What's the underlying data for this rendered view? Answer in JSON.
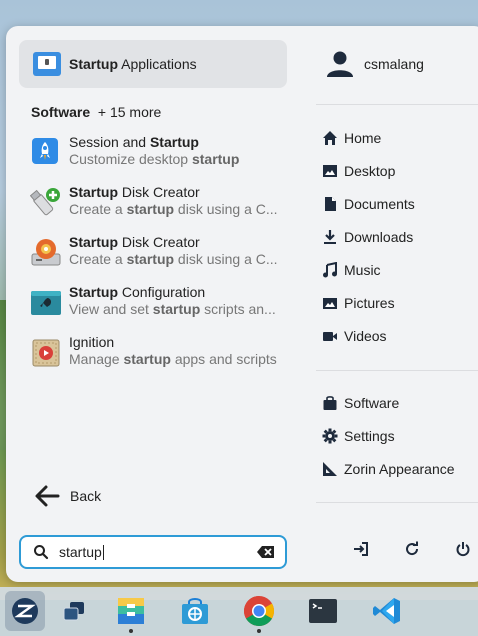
{
  "top_result": {
    "bold": "Startup",
    "rest": " Applications"
  },
  "category": {
    "name": "Software",
    "more": "+ 15 more"
  },
  "results": [
    {
      "t1_bold": "",
      "t1_rest": "Session and ",
      "t1_tail": "Startup",
      "t2_pre": "Customize desktop ",
      "t2_bold": "startup",
      "t2_post": "",
      "icon": "rocket-app-icon"
    },
    {
      "t1_bold": "Startup",
      "t1_rest": " Disk Creator",
      "t1_tail": "",
      "t2_pre": "Create a ",
      "t2_bold": "startup",
      "t2_post": " disk using a C...",
      "icon": "usb-creator-icon"
    },
    {
      "t1_bold": "Startup",
      "t1_rest": " Disk Creator",
      "t1_tail": "",
      "t2_pre": "Create a ",
      "t2_bold": "startup",
      "t2_post": " disk using a C...",
      "icon": "disk-creator-icon"
    },
    {
      "t1_bold": "Startup",
      "t1_rest": " Configuration",
      "t1_tail": "",
      "t2_pre": "View and set ",
      "t2_bold": "startup",
      "t2_post": " scripts an...",
      "icon": "startup-config-icon"
    },
    {
      "t1_bold": "",
      "t1_rest": "Ignition",
      "t1_tail": "",
      "t2_pre": "Manage ",
      "t2_bold": "startup",
      "t2_post": " apps and scripts",
      "icon": "ignition-icon"
    }
  ],
  "back_label": "Back",
  "search": {
    "value": "startup"
  },
  "user": {
    "name": "csmalang"
  },
  "places": [
    "Home",
    "Desktop",
    "Documents",
    "Downloads",
    "Music",
    "Pictures",
    "Videos"
  ],
  "apps": [
    "Software",
    "Settings",
    "Zorin Appearance"
  ],
  "colors": {
    "accent": "#2e9bd6",
    "menu_bg": "#f2f3f5",
    "highlight": "#e1e3e6"
  },
  "taskbar": [
    "zorin-menu-icon",
    "window-switcher-icon",
    "files-icon",
    "software-store-icon",
    "chrome-icon",
    "terminal-icon",
    "vscode-icon"
  ]
}
